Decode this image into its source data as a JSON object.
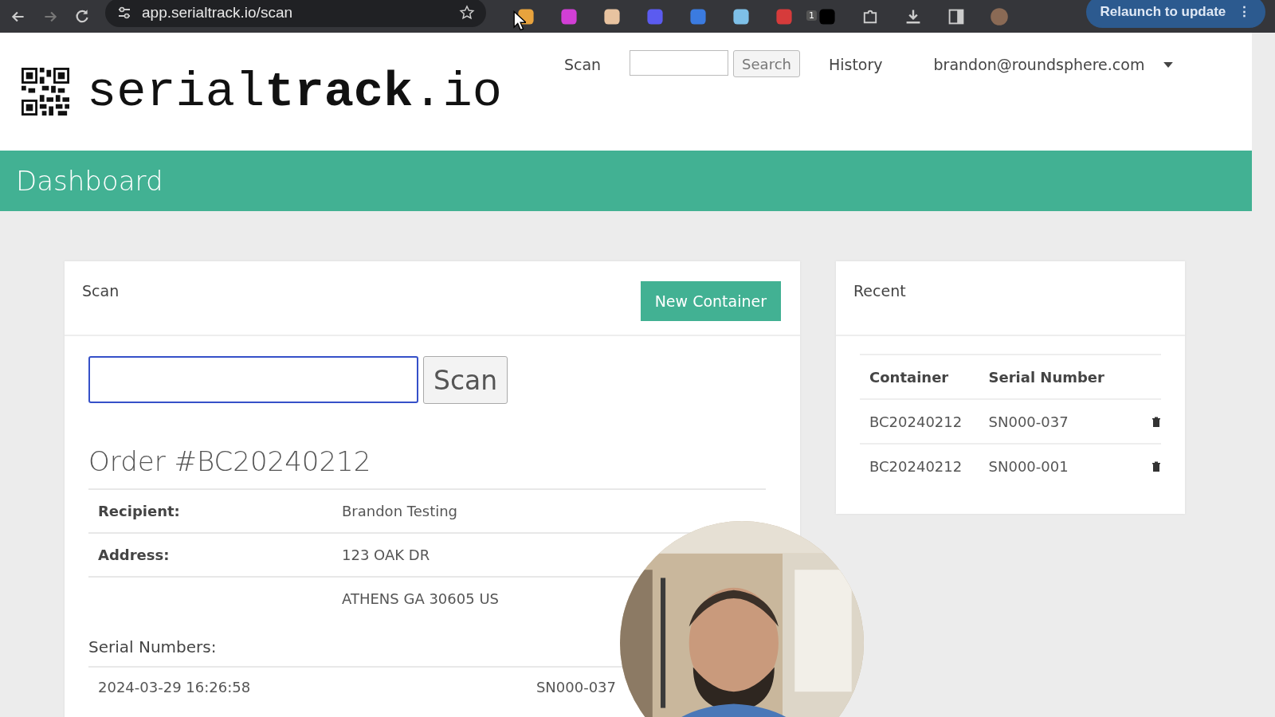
{
  "browser": {
    "url": "app.serialtrack.io/scan",
    "extension_badge": "1",
    "relaunch_label": "Relaunch to update",
    "menu_glyph": "⋮"
  },
  "header": {
    "logo": {
      "regular": "serial",
      "bold": "track",
      "suffix": ".io"
    },
    "nav": [
      {
        "kind": "link",
        "label": "Scan"
      },
      {
        "kind": "search",
        "button": "Search"
      },
      {
        "kind": "link",
        "label": "History"
      },
      {
        "kind": "user",
        "label": "brandon@roundsphere.com"
      }
    ]
  },
  "page_title": "Dashboard",
  "scan_card": {
    "title": "Scan",
    "new_button": "New Container",
    "scan_input": {
      "focused": true
    },
    "scan_button": "Scan",
    "order_title": "Order #BC20240212",
    "details": [
      {
        "label": "Recipient:",
        "value": "Brandon Testing"
      },
      {
        "label": "Address:",
        "value": "123 OAK DR"
      },
      {
        "value": "ATHENS GA 30605 US"
      }
    ],
    "serial_heading": "Serial Numbers:",
    "serials": [
      {
        "date": "2024-03-29 16:26:58",
        "serial": "SN000-037"
      }
    ]
  },
  "recent": {
    "title": "Recent",
    "columns": [
      "Container",
      "Serial Number"
    ],
    "rows": [
      {
        "container": "BC20240212",
        "serial": "SN000-037"
      },
      {
        "container": "BC20240212",
        "serial": "SN000-001"
      }
    ]
  }
}
